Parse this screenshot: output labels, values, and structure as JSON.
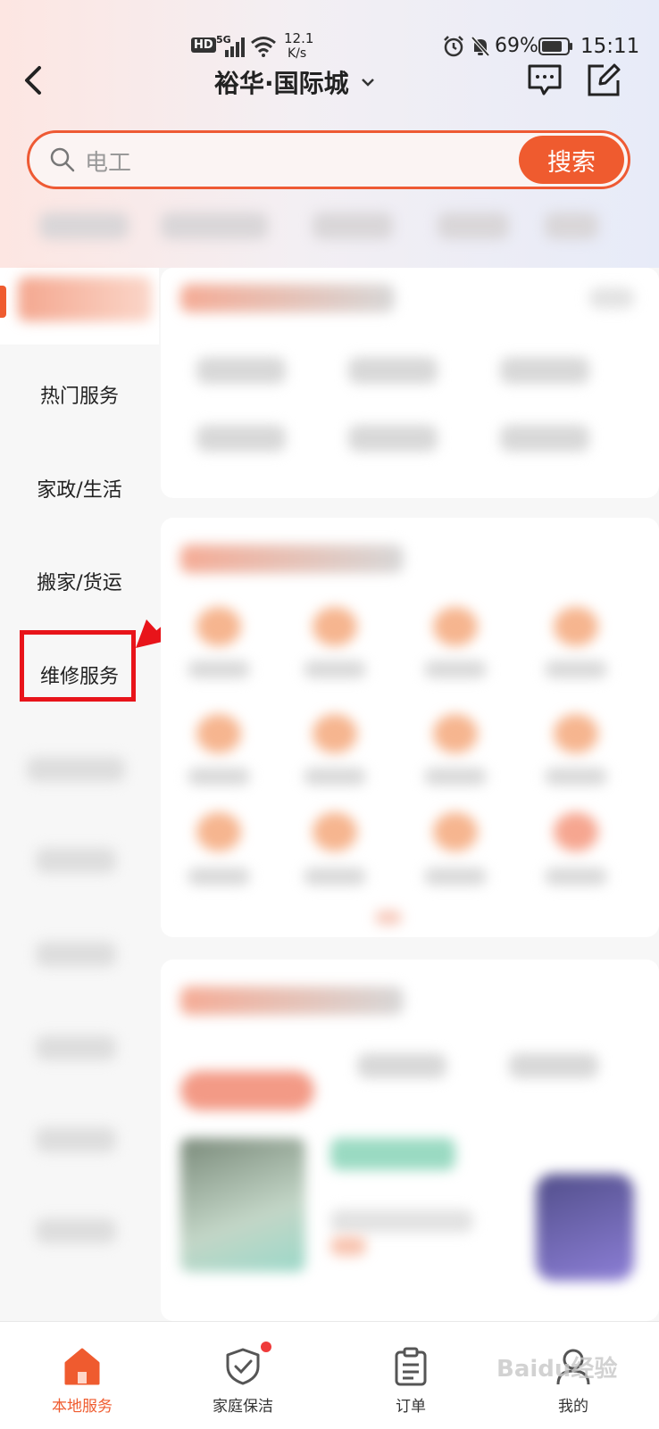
{
  "status_bar": {
    "network": "5G",
    "hd": "HD",
    "speed_value": "12.1",
    "speed_unit": "K/s",
    "battery": "69%",
    "time": "15:11"
  },
  "header": {
    "location": "裕华·国际城"
  },
  "search": {
    "placeholder": "电工",
    "button_label": "搜索"
  },
  "sidebar": {
    "items": [
      {
        "label": "热门服务"
      },
      {
        "label": "家政/生活"
      },
      {
        "label": "搬家/货运"
      },
      {
        "label": "维修服务"
      }
    ]
  },
  "bottom_nav": {
    "items": [
      {
        "label": "本地服务",
        "active": true
      },
      {
        "label": "家庭保洁"
      },
      {
        "label": "订单"
      },
      {
        "label": "我的"
      }
    ]
  },
  "watermark": "Baidu经验",
  "colors": {
    "accent": "#ef5b2f",
    "highlight": "#e8141a"
  }
}
